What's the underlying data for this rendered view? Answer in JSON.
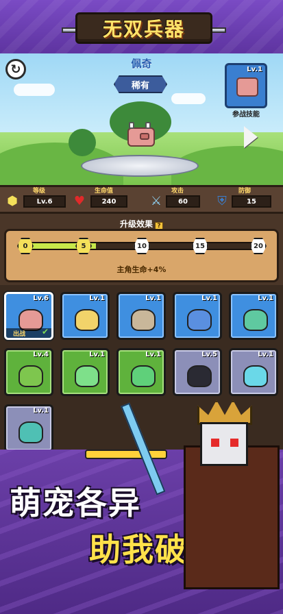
{
  "banner": {
    "title": "无双兵器"
  },
  "scene": {
    "pet_name": "佩奇",
    "rarity": "稀有",
    "skill_card": {
      "level": "Lv.1",
      "label": "参战技能"
    },
    "icons": {
      "refresh": "refresh-icon",
      "next": "arrow-right-icon"
    }
  },
  "stats": [
    {
      "label": "等级",
      "value": "Lv.6",
      "icon": "hexagon-level-icon"
    },
    {
      "label": "生命值",
      "value": "240",
      "icon": "heart-icon"
    },
    {
      "label": "攻击",
      "value": "60",
      "icon": "sword-icon"
    },
    {
      "label": "防御",
      "value": "15",
      "icon": "shield-icon"
    }
  ],
  "upgrade": {
    "title": "升级效果",
    "milestones": [
      "0",
      "5",
      "10",
      "15",
      "20"
    ],
    "progress": 0.3,
    "bonus": "主角生命+4%"
  },
  "pets": [
    {
      "level": "Lv.6",
      "color": "blue",
      "name": "pig",
      "equipped_label": "出战",
      "selected": true
    },
    {
      "level": "Lv.1",
      "color": "blue",
      "name": "yellow-chick"
    },
    {
      "level": "Lv.1",
      "color": "blue",
      "name": "owl"
    },
    {
      "level": "Lv.1",
      "color": "blue",
      "name": "pufferfish"
    },
    {
      "level": "Lv.1",
      "color": "blue",
      "name": "green-mushroom"
    },
    {
      "level": "Lv.4",
      "color": "green",
      "name": "frog"
    },
    {
      "level": "Lv.1",
      "color": "green",
      "name": "green-slime"
    },
    {
      "level": "Lv.1",
      "color": "green",
      "name": "leaf-slime"
    },
    {
      "level": "Lv.5",
      "color": "purple",
      "name": "crow"
    },
    {
      "level": "Lv.1",
      "color": "purple",
      "name": "blue-slime"
    },
    {
      "level": "Lv.1",
      "color": "purple",
      "name": "teal-mushroom"
    }
  ],
  "promo": {
    "line1": "萌宠各异",
    "line2": "助我破关"
  },
  "colors": {
    "accent": "#ffe14a",
    "panel": "#4a3628",
    "sky": "#9fd8f5"
  }
}
